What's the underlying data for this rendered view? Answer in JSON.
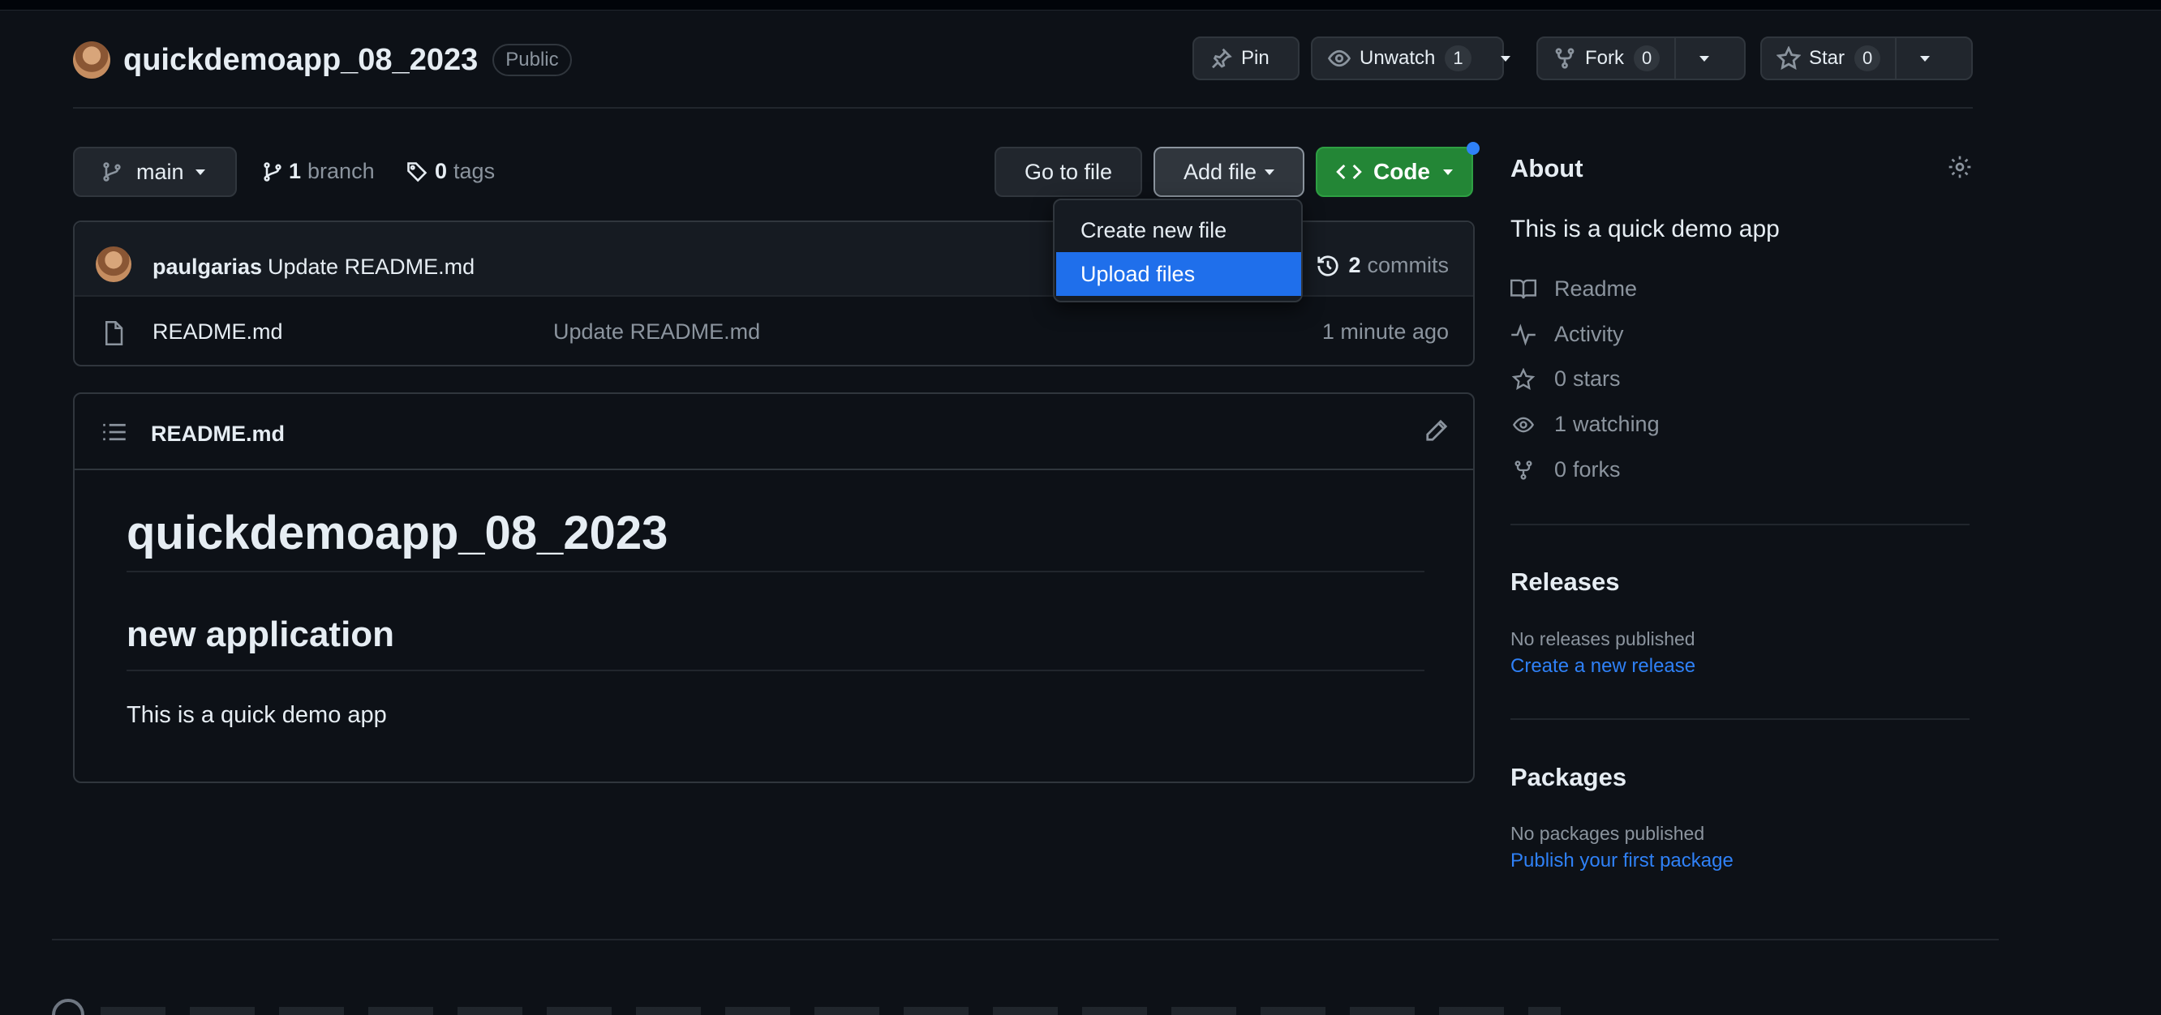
{
  "repo": {
    "name": "quickdemoapp_08_2023",
    "visibility": "Public"
  },
  "actions": {
    "pin": "Pin",
    "unwatch": "Unwatch",
    "watch_count": "1",
    "fork": "Fork",
    "fork_count": "0",
    "star": "Star",
    "star_count": "0"
  },
  "branch_bar": {
    "branch": "main",
    "branch_count": "1",
    "branch_label": "branch",
    "tag_count": "0",
    "tag_label": "tags",
    "go_to_file": "Go to file",
    "add_file": "Add file",
    "code": "Code"
  },
  "add_file_menu": {
    "items": [
      "Create new file",
      "Upload files"
    ],
    "selected": "Upload files"
  },
  "latest_commit": {
    "author": "paulgarias",
    "message": "Update README.md",
    "commit_count": "2",
    "commit_label": "commits"
  },
  "files": [
    {
      "name": "README.md",
      "message": "Update README.md",
      "age": "1 minute ago"
    }
  ],
  "readme": {
    "header": "README.md",
    "h1": "quickdemoapp_08_2023",
    "h2": "new application",
    "paragraph": "This is a quick demo app"
  },
  "sidebar": {
    "about_title": "About",
    "description": "This is a quick demo app",
    "links": {
      "readme": "Readme",
      "activity": "Activity",
      "stars_count": "0",
      "stars_label": "stars",
      "watching_count": "1",
      "watching_label": "watching",
      "forks_count": "0",
      "forks_label": "forks"
    },
    "releases_title": "Releases",
    "releases_empty": "No releases published",
    "releases_link": "Create a new release",
    "packages_title": "Packages",
    "packages_empty": "No packages published",
    "packages_link": "Publish your first package"
  },
  "colors": {
    "background": "#0d1117",
    "accent_blue": "#1f6feb",
    "code_green": "#238636"
  }
}
